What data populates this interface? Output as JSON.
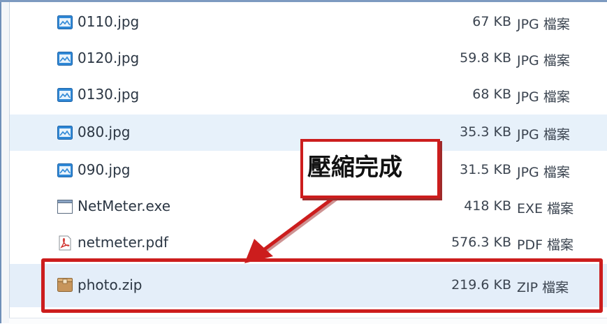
{
  "files": [
    {
      "name": "0110.jpg",
      "size": "67 KB",
      "type": "JPG 檔案",
      "icon": "image-file-icon"
    },
    {
      "name": "0120.jpg",
      "size": "59.8 KB",
      "type": "JPG 檔案",
      "icon": "image-file-icon"
    },
    {
      "name": "0130.jpg",
      "size": "68 KB",
      "type": "JPG 檔案",
      "icon": "image-file-icon"
    },
    {
      "name": "080.jpg",
      "size": "35.3 KB",
      "type": "JPG 檔案",
      "icon": "image-file-icon"
    },
    {
      "name": "090.jpg",
      "size": "31.5 KB",
      "type": "JPG 檔案",
      "icon": "image-file-icon"
    },
    {
      "name": "NetMeter.exe",
      "size": "418 KB",
      "type": "EXE 檔案",
      "icon": "executable-file-icon"
    },
    {
      "name": "netmeter.pdf",
      "size": "576.3 KB",
      "type": "PDF 檔案",
      "icon": "pdf-file-icon"
    },
    {
      "name": "photo.zip",
      "size": "219.6 KB",
      "type": "ZIP 檔案",
      "icon": "zip-archive-icon"
    }
  ],
  "annotation": {
    "callout_text": "壓縮完成"
  },
  "colors": {
    "annotation_red": "#cc1d1d",
    "row_highlight": "#e7f1fa",
    "text": "#2b3643"
  }
}
